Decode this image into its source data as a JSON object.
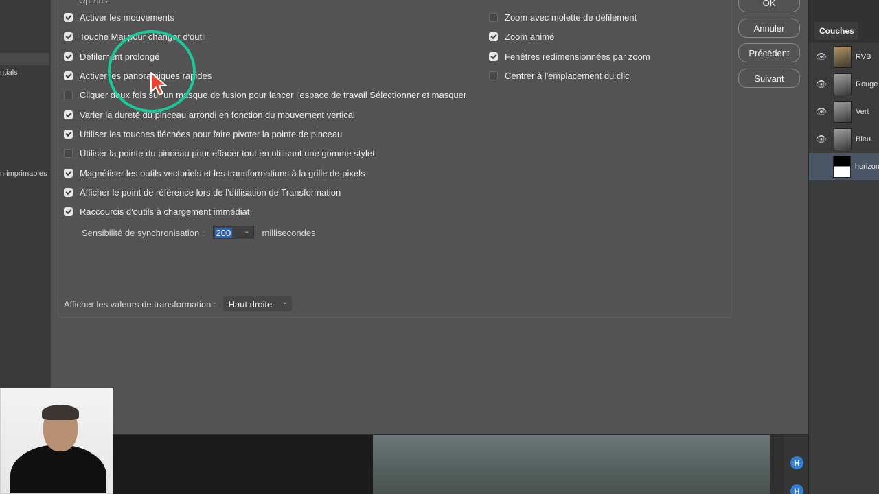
{
  "background": {
    "left_panel_labels": [
      "ntials",
      "n imprimables"
    ]
  },
  "dialog": {
    "group_title": "Options",
    "left_options": [
      {
        "label": "Activer les mouvements",
        "checked": true
      },
      {
        "label": "Touche Maj pour changer d'outil",
        "checked": true
      },
      {
        "label": "Défilement prolongé",
        "checked": true
      },
      {
        "label": "Activer les panoramiques rapides",
        "checked": true
      },
      {
        "label": "Cliquer deux fois sur un masque de fusion pour lancer l'espace de travail Sélectionner et masquer",
        "checked": false
      },
      {
        "label": "Varier la dureté du pinceau arrondi en fonction du mouvement vertical",
        "checked": true
      },
      {
        "label": "Utiliser les touches fléchées pour faire pivoter la pointe de pinceau",
        "checked": true
      },
      {
        "label": "Utiliser la pointe du pinceau pour effacer tout en utilisant une gomme stylet",
        "checked": false
      },
      {
        "label": "Magnétiser les outils vectoriels et les transformations à la grille de pixels",
        "checked": true
      },
      {
        "label": "Afficher le point de référence lors de l'utilisation de Transformation",
        "checked": true
      },
      {
        "label": "Raccourcis d'outils à chargement immédiat",
        "checked": true
      }
    ],
    "right_options": [
      {
        "label": "Zoom avec molette de défilement",
        "checked": false
      },
      {
        "label": "Zoom animé",
        "checked": true
      },
      {
        "label": "Fenêtres redimensionnées par zoom",
        "checked": true
      },
      {
        "label": "Centrer à l'emplacement du clic",
        "checked": false
      }
    ],
    "sync": {
      "label": "Sensibilité de synchronisation :",
      "value": "200",
      "unit": "millisecondes"
    },
    "transform": {
      "label": "Afficher les valeurs de transformation :",
      "value": "Haut droite"
    },
    "buttons": {
      "ok": "OK",
      "cancel": "Annuler",
      "prev": "Précédent",
      "next": "Suivant"
    }
  },
  "channels": {
    "tab": "Couches",
    "items": [
      {
        "name": "RVB",
        "visible": true,
        "thumb": "rgb"
      },
      {
        "name": "Rouge",
        "visible": true,
        "thumb": "gray"
      },
      {
        "name": "Vert",
        "visible": true,
        "thumb": "gray"
      },
      {
        "name": "Bleu",
        "visible": true,
        "thumb": "gray"
      },
      {
        "name": "horizon",
        "visible": false,
        "thumb": "mask",
        "selected": true
      }
    ]
  },
  "badges": {
    "h": "H"
  },
  "colors": {
    "dialog_bg": "#535353",
    "accent_ring": "#19c99a",
    "cursor": "#e8452f",
    "selection": "#2f62b0"
  }
}
